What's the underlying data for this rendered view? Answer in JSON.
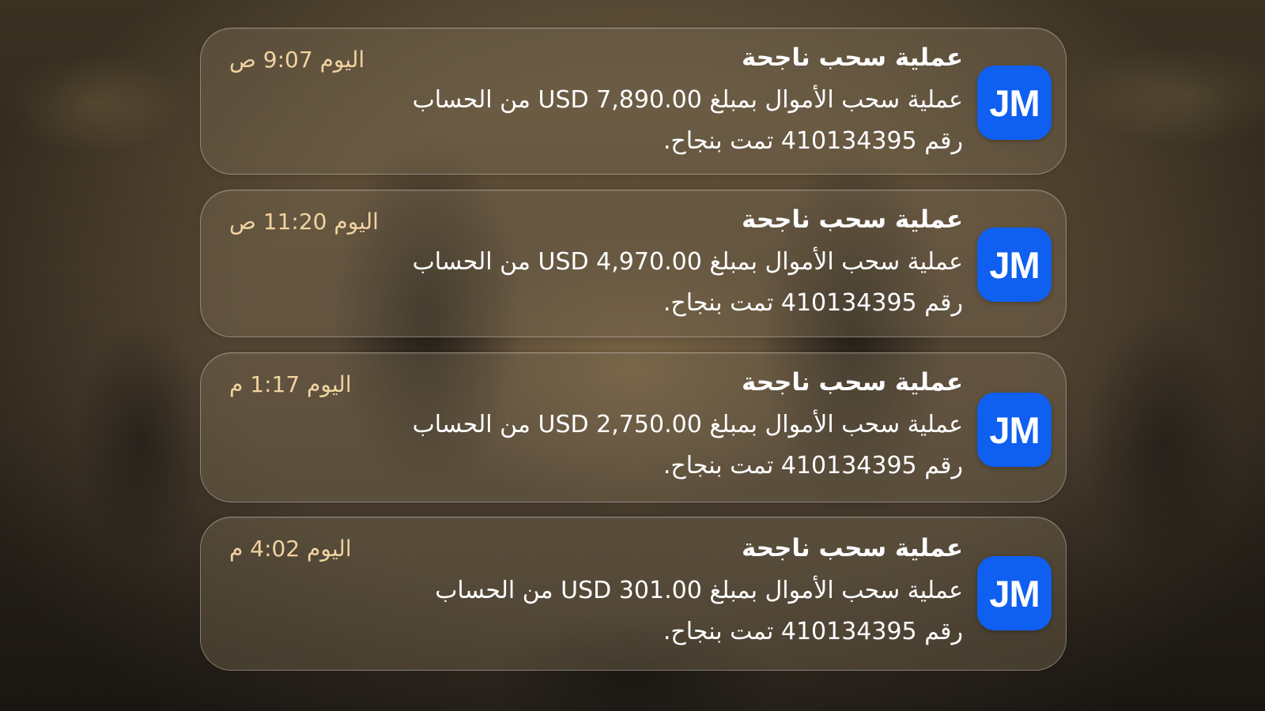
{
  "notifications": [
    {
      "app_icon_text": "JM",
      "title": "عملية سحب ناجحة",
      "day": "اليوم",
      "time": "9:07",
      "period": "ص",
      "body_prefix": "عملية سحب الأموال بمبلغ",
      "amount": "USD 7,890.00",
      "body_suffix": "من الحساب",
      "account_prefix": "رقم",
      "account_number": "410134395",
      "status_text": "تمت بنجاح."
    },
    {
      "app_icon_text": "JM",
      "title": "عملية سحب ناجحة",
      "day": "اليوم",
      "time": "11:20",
      "period": "ص",
      "body_prefix": "عملية سحب الأموال بمبلغ",
      "amount": "USD 4,970.00",
      "body_suffix": "من الحساب",
      "account_prefix": "رقم",
      "account_number": "410134395",
      "status_text": "تمت بنجاح."
    },
    {
      "app_icon_text": "JM",
      "title": "عملية سحب ناجحة",
      "day": "اليوم",
      "time": "1:17",
      "period": "م",
      "body_prefix": "عملية سحب الأموال بمبلغ",
      "amount": "USD 2,750.00",
      "body_suffix": "من الحساب",
      "account_prefix": "رقم",
      "account_number": "410134395",
      "status_text": "تمت بنجاح."
    },
    {
      "app_icon_text": "JM",
      "title": "عملية سحب ناجحة",
      "day": "اليوم",
      "time": "4:02",
      "period": "م",
      "body_prefix": "عملية سحب الأموال بمبلغ",
      "amount": "USD 301.00",
      "body_suffix": "من الحساب",
      "account_prefix": "رقم",
      "account_number": "410134395",
      "status_text": "تمت بنجاح."
    }
  ],
  "colors": {
    "app_icon_background": "#0f5ff0",
    "time_text": "#f0d3a0",
    "primary_text": "#ffffff"
  }
}
